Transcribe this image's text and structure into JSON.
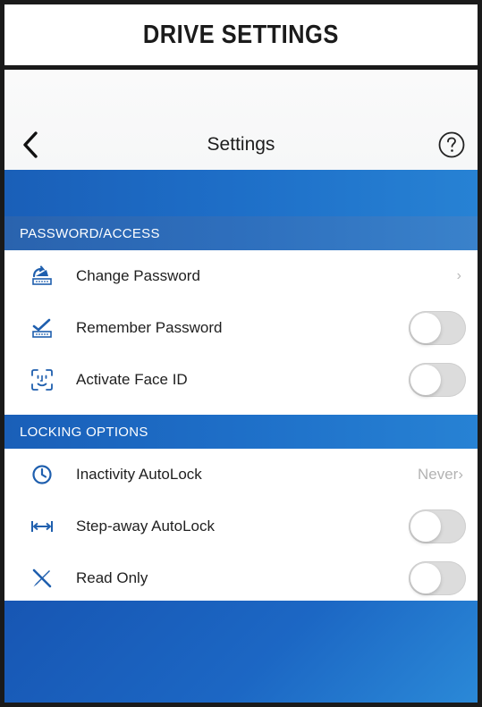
{
  "banner": {
    "title": "DRIVE SETTINGS"
  },
  "navbar": {
    "title": "Settings",
    "back_icon": "chevron-left-icon",
    "help_icon": "question-circle-icon"
  },
  "sections": [
    {
      "header": "PASSWORD/ACCESS",
      "rows": [
        {
          "label": "Change Password",
          "icon": "key-reset-icon",
          "control": "chevron",
          "chevron": "›"
        },
        {
          "label": "Remember Password",
          "icon": "password-check-icon",
          "control": "toggle",
          "on": false
        },
        {
          "label": "Activate Face ID",
          "icon": "face-id-icon",
          "control": "toggle",
          "on": false
        }
      ]
    },
    {
      "header": "LOCKING OPTIONS",
      "rows": [
        {
          "label": "Inactivity AutoLock",
          "icon": "clock-icon",
          "control": "value",
          "value": "Never›"
        },
        {
          "label": "Step-away AutoLock",
          "icon": "distance-arrows-icon",
          "control": "toggle",
          "on": false
        },
        {
          "label": "Read Only",
          "icon": "pencil-cross-icon",
          "control": "toggle",
          "on": false
        }
      ]
    }
  ],
  "colors": {
    "accent_blue": "#1e6fc8",
    "icon_blue": "#1f5fae",
    "toggle_off": "#dcdcdc"
  }
}
